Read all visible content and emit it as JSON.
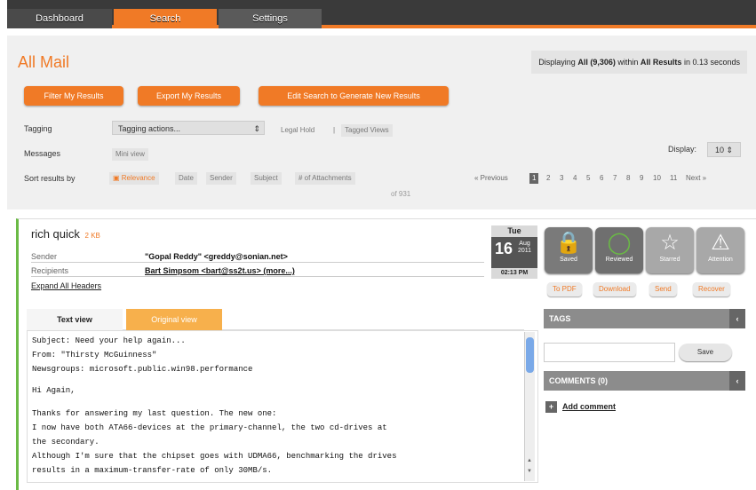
{
  "colors": {
    "accent": "#f07a26",
    "nav_bg": "#3a3a3a",
    "read_marker": "#6aba45"
  },
  "nav": {
    "dashboard": "Dashboard",
    "search": "Search",
    "settings": "Settings"
  },
  "page_title": "All Mail",
  "status": {
    "prefix": "Displaying",
    "count": "All (9,306)",
    "within": "within",
    "scope": "All Results",
    "suffix": "in 0.13 seconds"
  },
  "actions": {
    "filter": "Filter My Results",
    "export": "Export My Results",
    "edit": "Edit Search to Generate New Results"
  },
  "tagging": {
    "label": "Tagging",
    "select": "Tagging actions...",
    "legal_hold": "Legal Hold",
    "sep": "|",
    "tagged_views": "Tagged Views"
  },
  "messages": {
    "label": "Messages",
    "mini_view": "Mini view"
  },
  "display": {
    "label": "Display:",
    "value": "10"
  },
  "sort": {
    "label": "Sort results by",
    "options": [
      "Relevance",
      "Date",
      "Sender",
      "Subject",
      "# of Attachments"
    ]
  },
  "pager": {
    "previous": "« Previous",
    "pages": [
      "1",
      "2",
      "3",
      "4",
      "5",
      "6",
      "7",
      "8",
      "9",
      "10",
      "11"
    ],
    "next": "Next »",
    "current": "1",
    "of": "of 931"
  },
  "message": {
    "subject": "rich quick",
    "size": "2 KB",
    "sender_label": "Sender",
    "sender": "\"Gopal Reddy\" <greddy@sonian.net>",
    "recipients_label": "Recipients",
    "recipients": "Bart Simpsom <bart@ss2t.us> (more...)",
    "expand": "Expand All Headers",
    "date": {
      "dow": "Tue",
      "day": "16",
      "month": "Aug",
      "year": "2011",
      "time": "02:13 PM"
    }
  },
  "icons": {
    "saved": "lock-icon",
    "reviewed": "circle-icon",
    "starred": "star-icon",
    "attention": "warning-icon"
  },
  "action_icons": [
    {
      "label": "Saved",
      "glyph": "🔒"
    },
    {
      "label": "Reviewed",
      "glyph": "◯"
    },
    {
      "label": "Starred",
      "glyph": "☆"
    },
    {
      "label": "Attention",
      "glyph": "⚠"
    }
  ],
  "small_buttons": {
    "pdf": "To PDF",
    "download": "Download",
    "send": "Send",
    "recover": "Recover"
  },
  "tabs": {
    "text_view": "Text view",
    "original_view": "Original view"
  },
  "body_lines": [
    "Subject: Need your help again...",
    "From: \"Thirsty McGuinness\"",
    "Newsgroups: microsoft.public.win98.performance",
    "",
    "Hi Again,",
    "",
    "Thanks for answering my last question. The new one:",
    "I now have both ATA66-devices at the primary-channel, the two cd-drives at",
    "the secondary.",
    "Although I'm sure that the chipset goes with UDMA66, benchmarking the drives",
    "results in a maximum-transfer-rate of only 30MB/s."
  ],
  "sidebar": {
    "tags": "TAGS",
    "save": "Save",
    "comments": "COMMENTS (0)",
    "add_comment": "Add comment",
    "chevron": "‹"
  }
}
